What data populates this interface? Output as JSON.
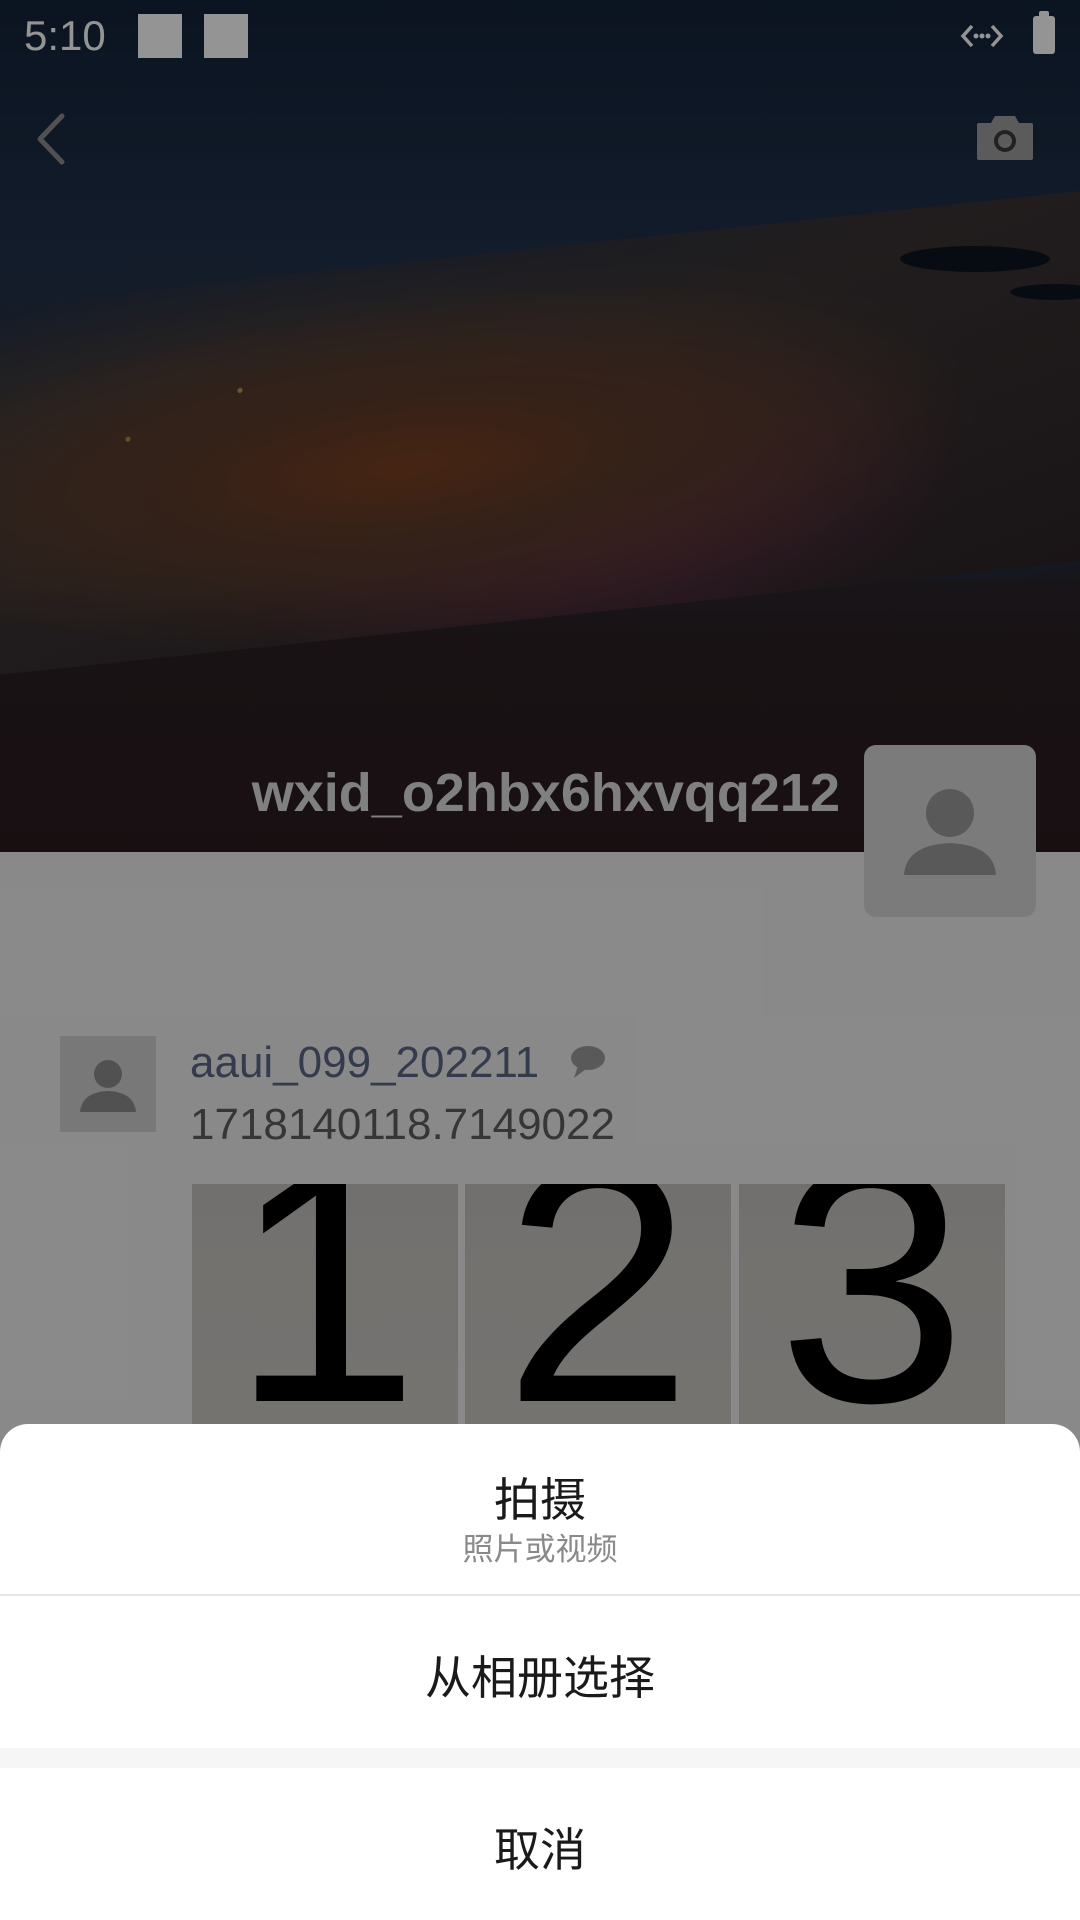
{
  "status_bar": {
    "time": "5:10",
    "icons": [
      "notification-square-icon",
      "notification-square-icon",
      "data-transfer-icon",
      "battery-icon"
    ]
  },
  "header": {
    "back_icon": "chevron-left-icon",
    "camera_icon": "camera-icon"
  },
  "profile": {
    "username": "wxid_o2hbx6hxvqq212",
    "avatar_icon": "default-avatar-icon"
  },
  "post": {
    "author": "aaui_099_202211",
    "author_badge_icon": "chat-bubble-icon",
    "text": "1718140118.7149022",
    "images": [
      "1",
      "2",
      "3"
    ]
  },
  "action_sheet": {
    "shoot_label": "拍摄",
    "shoot_sublabel": "照片或视频",
    "album_label": "从相册选择",
    "cancel_label": "取消"
  },
  "colors": {
    "overlay": "#000000",
    "sheet_bg": "#ffffff",
    "author_name": "#596783"
  }
}
